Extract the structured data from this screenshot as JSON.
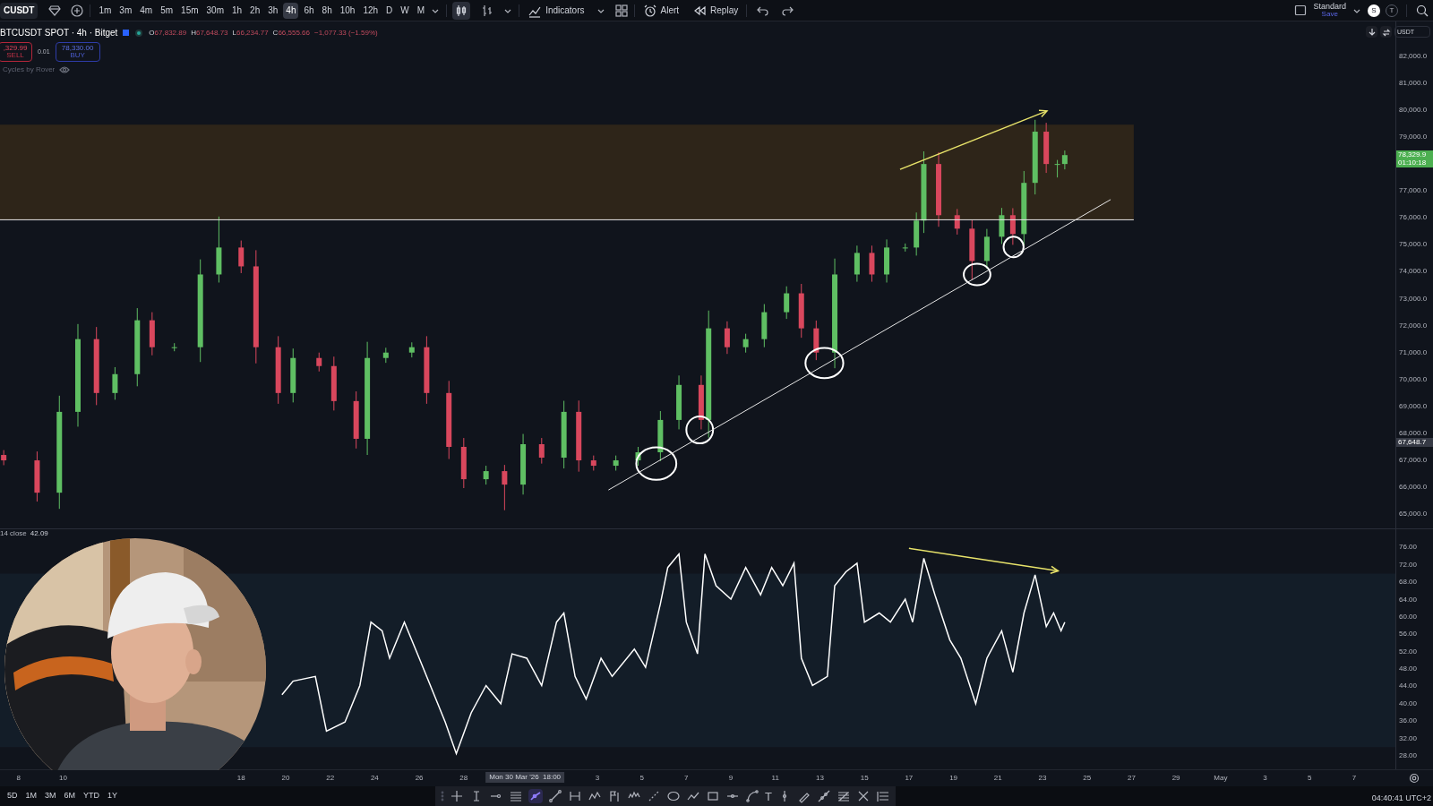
{
  "toolbar": {
    "symbol": "CUSDT",
    "intervals": [
      {
        "label": "1m",
        "selected": false
      },
      {
        "label": "3m",
        "selected": false
      },
      {
        "label": "4m",
        "selected": false
      },
      {
        "label": "5m",
        "selected": false
      },
      {
        "label": "15m",
        "selected": false
      },
      {
        "label": "30m",
        "selected": false
      },
      {
        "label": "1h",
        "selected": false
      },
      {
        "label": "2h",
        "selected": false
      },
      {
        "label": "3h",
        "selected": false
      },
      {
        "label": "4h",
        "selected": true
      },
      {
        "label": "6h",
        "selected": false
      },
      {
        "label": "8h",
        "selected": false
      },
      {
        "label": "10h",
        "selected": false
      },
      {
        "label": "12h",
        "selected": false
      },
      {
        "label": "D",
        "selected": false
      },
      {
        "label": "W",
        "selected": false
      },
      {
        "label": "M",
        "selected": false
      }
    ],
    "indicators_label": "Indicators",
    "alert_label": "Alert",
    "replay_label": "Replay",
    "layout_name": "Standard",
    "layout_action": "Save",
    "avatars": [
      {
        "letter": "S",
        "kind": "filled"
      },
      {
        "letter": "T",
        "kind": "outline"
      }
    ]
  },
  "legend": {
    "title": "BTCUSDT SPOT · 4h · Bitget",
    "ohlc": [
      {
        "key": "O",
        "value": "67,832.89"
      },
      {
        "key": "H",
        "value": "67,648.73"
      },
      {
        "key": "L",
        "value": "66,234.77"
      },
      {
        "key": "C",
        "value": "66,555.66"
      }
    ],
    "change": "−1,077.33 (−1.59%)"
  },
  "trade": {
    "sell_price": ",329.99",
    "sell_label": "SELL",
    "spread": "0.01",
    "buy_price": "78,330.00",
    "buy_label": "BUY"
  },
  "indicators": [
    {
      "name": "Cycles by Rover"
    }
  ],
  "currency": "USDT",
  "price_chart": {
    "chart_data": {
      "type": "candlestick",
      "xlim": [
        "2026-03-07T04:00",
        "2026-05-10T13:00"
      ],
      "ylim": [
        64475,
        83290
      ],
      "x": [
        "2026-03-07T08:00",
        "2026-03-08T20:00",
        "2026-03-09T20:00",
        "2026-03-10T16:00",
        "2026-03-11T12:00",
        "2026-03-12T08:00",
        "2026-03-13T08:00",
        "2026-03-14T00:00",
        "2026-03-15T00:00",
        "2026-03-16T04:00",
        "2026-03-17T00:00",
        "2026-03-18T00:00",
        "2026-03-18T16:00",
        "2026-03-19T16:00",
        "2026-03-20T08:00",
        "2026-03-21T12:00",
        "2026-03-22T04:00",
        "2026-03-23T04:00",
        "2026-03-23T16:00",
        "2026-03-24T12:00",
        "2026-03-25T16:00",
        "2026-03-26T08:00",
        "2026-03-27T08:00",
        "2026-03-28T00:00",
        "2026-03-29T00:00",
        "2026-03-29T20:00",
        "2026-03-30T16:00",
        "2026-03-31T12:00",
        "2026-04-01T12:00",
        "2026-04-02T04:00",
        "2026-04-02T20:00",
        "2026-04-03T20:00",
        "2026-04-04T20:00",
        "2026-04-05T20:00",
        "2026-04-06T16:00",
        "2026-04-07T16:00",
        "2026-04-08T00:00",
        "2026-04-08T20:00",
        "2026-04-09T16:00",
        "2026-04-10T12:00",
        "2026-04-11T12:00",
        "2026-04-12T04:00",
        "2026-04-12T20:00",
        "2026-04-13T16:00",
        "2026-04-14T16:00",
        "2026-04-15T08:00",
        "2026-04-16T00:00",
        "2026-04-16T20:00",
        "2026-04-17T08:00",
        "2026-04-17T16:00",
        "2026-04-18T08:00",
        "2026-04-19T04:00",
        "2026-04-19T20:00",
        "2026-04-20T12:00",
        "2026-04-21T04:00",
        "2026-04-21T16:00",
        "2026-04-22T04:00",
        "2026-04-22T16:00",
        "2026-04-23T04:00",
        "2026-04-23T16:00",
        "2026-04-24T00:00"
      ],
      "ohlc": [
        [
          67200,
          67380,
          66820,
          67000
        ],
        [
          67000,
          67330,
          65470,
          65800
        ],
        [
          65800,
          69400,
          65200,
          68800
        ],
        [
          68800,
          72060,
          68250,
          71500
        ],
        [
          71500,
          71950,
          69050,
          69500
        ],
        [
          69500,
          70460,
          69250,
          70200
        ],
        [
          70200,
          72650,
          69750,
          72200
        ],
        [
          72200,
          72500,
          70900,
          71200
        ],
        [
          71200,
          71350,
          71050,
          71200
        ],
        [
          71200,
          74460,
          70650,
          73900
        ],
        [
          73900,
          76050,
          73600,
          74900
        ],
        [
          74900,
          75160,
          73950,
          74200
        ],
        [
          74200,
          74800,
          70600,
          71200
        ],
        [
          71200,
          71610,
          69100,
          69500
        ],
        [
          69500,
          71150,
          69150,
          70800
        ],
        [
          70800,
          71000,
          70300,
          70500
        ],
        [
          70500,
          70850,
          68850,
          69200
        ],
        [
          69200,
          69560,
          67440,
          67800
        ],
        [
          67800,
          71400,
          67200,
          70800
        ],
        [
          70800,
          71180,
          70620,
          71000
        ],
        [
          71000,
          71380,
          70820,
          71200
        ],
        [
          71200,
          71610,
          69100,
          69500
        ],
        [
          69500,
          69950,
          67050,
          67500
        ],
        [
          67500,
          67830,
          65970,
          66300
        ],
        [
          66300,
          66800,
          66100,
          66600
        ],
        [
          66600,
          66830,
          65150,
          66100
        ],
        [
          66100,
          67980,
          65730,
          67600
        ],
        [
          67600,
          67830,
          66880,
          67100
        ],
        [
          67100,
          69210,
          66700,
          68800
        ],
        [
          68800,
          69220,
          66580,
          67000
        ],
        [
          67000,
          67180,
          66620,
          66800
        ],
        [
          66800,
          67180,
          66620,
          67000
        ],
        [
          67000,
          67500,
          66800,
          67300
        ],
        [
          67300,
          68830,
          66970,
          68500
        ],
        [
          68500,
          70150,
          68150,
          69800
        ],
        [
          69800,
          70150,
          68150,
          68500
        ],
        [
          68500,
          72560,
          67840,
          71900
        ],
        [
          71900,
          72160,
          70950,
          71200
        ],
        [
          71200,
          71700,
          71000,
          71500
        ],
        [
          71500,
          72800,
          71200,
          72500
        ],
        [
          72500,
          73460,
          72250,
          73200
        ],
        [
          73200,
          73550,
          71550,
          71900
        ],
        [
          71900,
          72190,
          70720,
          71000
        ],
        [
          71000,
          74490,
          70420,
          73900
        ],
        [
          73900,
          74970,
          73630,
          74700
        ],
        [
          74700,
          74970,
          73630,
          73900
        ],
        [
          73900,
          75200,
          73600,
          74900
        ],
        [
          74900,
          75050,
          74750,
          74900
        ],
        [
          74900,
          76200,
          74600,
          75900
        ],
        [
          75900,
          78470,
          75440,
          78000
        ],
        [
          78000,
          78440,
          75670,
          76100
        ],
        [
          76100,
          76330,
          75380,
          75600
        ],
        [
          75600,
          75930,
          73700,
          74400
        ],
        [
          74400,
          75590,
          74120,
          75300
        ],
        [
          75300,
          76370,
          75030,
          76100
        ],
        [
          76100,
          76360,
          75000,
          75400
        ],
        [
          75400,
          77740,
          74970,
          77300
        ],
        [
          77300,
          79640,
          76870,
          79200
        ],
        [
          79200,
          79530,
          77670,
          78000
        ],
        [
          78000,
          78150,
          77500,
          78000
        ],
        [
          78000,
          78500,
          77800,
          78330
        ]
      ],
      "yticks": [
        {
          "value": 82000,
          "label": "82,000.0"
        },
        {
          "value": 81000,
          "label": "81,000.0"
        },
        {
          "value": 80000,
          "label": "80,000.0"
        },
        {
          "value": 79000,
          "label": "79,000.0"
        },
        {
          "value": 77000,
          "label": "77,000.0"
        },
        {
          "value": 76000,
          "label": "76,000.0"
        },
        {
          "value": 75000,
          "label": "75,000.0"
        },
        {
          "value": 74000,
          "label": "74,000.0"
        },
        {
          "value": 73000,
          "label": "73,000.0"
        },
        {
          "value": 72000,
          "label": "72,000.0"
        },
        {
          "value": 71000,
          "label": "71,000.0"
        },
        {
          "value": 70000,
          "label": "70,000.0"
        },
        {
          "value": 69000,
          "label": "69,000.0"
        },
        {
          "value": 68000,
          "label": "68,000.0"
        },
        {
          "value": 67000,
          "label": "67,000.0"
        },
        {
          "value": 66000,
          "label": "66,000.0"
        },
        {
          "value": 65000,
          "label": "65,000.0"
        }
      ]
    },
    "price_labels": [
      {
        "kind": "last",
        "label": "78,329.9",
        "countdown": "01:10:18"
      },
      {
        "kind": "high",
        "label": "67,648.7"
      }
    ]
  },
  "rsi": {
    "label": "14 close",
    "value": "42.09",
    "chart_data": {
      "type": "line",
      "xlim": [
        "2026-03-07T04:00",
        "2026-05-10T13:00"
      ],
      "ylim": [
        24.7,
        80.2
      ],
      "x": [
        "2026-03-19T20:00",
        "2026-03-20T08:00",
        "2026-03-21T08:00",
        "2026-03-21T20:00",
        "2026-03-22T16:00",
        "2026-03-23T08:00",
        "2026-03-23T20:00",
        "2026-03-24T08:00",
        "2026-03-24T16:00",
        "2026-03-25T08:00",
        "2026-03-26T00:00",
        "2026-03-26T16:00",
        "2026-03-27T04:00",
        "2026-03-27T16:00",
        "2026-03-28T08:00",
        "2026-03-29T00:00",
        "2026-03-29T16:00",
        "2026-03-30T04:00",
        "2026-03-30T20:00",
        "2026-03-31T12:00",
        "2026-04-01T04:00",
        "2026-04-01T12:00",
        "2026-04-02T00:00",
        "2026-04-02T12:00",
        "2026-04-03T04:00",
        "2026-04-03T16:00",
        "2026-04-04T16:00",
        "2026-04-05T04:00",
        "2026-04-05T20:00",
        "2026-04-06T04:00",
        "2026-04-06T16:00",
        "2026-04-07T00:00",
        "2026-04-07T12:00",
        "2026-04-07T20:00",
        "2026-04-08T08:00",
        "2026-04-09T00:00",
        "2026-04-09T16:00",
        "2026-04-10T08:00",
        "2026-04-10T20:00",
        "2026-04-11T08:00",
        "2026-04-11T20:00",
        "2026-04-12T04:00",
        "2026-04-12T16:00",
        "2026-04-13T08:00",
        "2026-04-13T16:00",
        "2026-04-14T04:00",
        "2026-04-14T16:00",
        "2026-04-15T00:00",
        "2026-04-15T16:00",
        "2026-04-16T04:00",
        "2026-04-16T20:00",
        "2026-04-17T04:00",
        "2026-04-17T16:00",
        "2026-04-18T04:00",
        "2026-04-18T20:00",
        "2026-04-19T08:00",
        "2026-04-20T00:00",
        "2026-04-20T12:00",
        "2026-04-21T04:00",
        "2026-04-21T16:00",
        "2026-04-22T04:00",
        "2026-04-22T16:00",
        "2026-04-23T04:00",
        "2026-04-23T12:00",
        "2026-04-23T20:00",
        "2026-04-24T00:00"
      ],
      "series": [
        {
          "color": "#ffffff",
          "values": [
            42.1,
            45.2,
            46.3,
            33.7,
            35.8,
            44.2,
            58.8,
            56.8,
            50.5,
            58.8,
            50.5,
            42.1,
            35.8,
            28.5,
            37.9,
            44.2,
            40.0,
            51.5,
            50.5,
            44.2,
            58.8,
            60.9,
            46.3,
            41.1,
            50.5,
            46.3,
            52.6,
            48.4,
            63.0,
            71.4,
            74.5,
            58.8,
            51.5,
            74.5,
            67.2,
            64.1,
            71.4,
            65.1,
            71.4,
            67.2,
            72.4,
            50.5,
            44.2,
            46.3,
            67.2,
            70.4,
            72.4,
            58.8,
            60.9,
            58.8,
            64.1,
            58.8,
            73.5,
            65.1,
            54.7,
            50.5,
            40.0,
            50.5,
            56.8,
            47.3,
            60.9,
            69.7,
            57.8,
            60.9,
            56.8,
            58.8
          ]
        }
      ],
      "yticks": [
        {
          "value": 76,
          "label": "76.00"
        },
        {
          "value": 72,
          "label": "72.00"
        },
        {
          "value": 68,
          "label": "68.00"
        },
        {
          "value": 64,
          "label": "64.00"
        },
        {
          "value": 60,
          "label": "60.00"
        },
        {
          "value": 56,
          "label": "56.00"
        },
        {
          "value": 52,
          "label": "52.00"
        },
        {
          "value": 48,
          "label": "48.00"
        },
        {
          "value": 44,
          "label": "44.00"
        },
        {
          "value": 40,
          "label": "40.00"
        },
        {
          "value": 36,
          "label": "36.00"
        },
        {
          "value": 32,
          "label": "32.00"
        },
        {
          "value": 28,
          "label": "28.00"
        }
      ],
      "xticks": [
        {
          "value": "2026-03-08T00:00",
          "label": "8"
        },
        {
          "value": "2026-03-10T00:00",
          "label": "10"
        },
        {
          "value": "2026-03-18T00:00",
          "label": "18"
        },
        {
          "value": "2026-03-20T00:00",
          "label": "20"
        },
        {
          "value": "2026-03-22T00:00",
          "label": "22"
        },
        {
          "value": "2026-03-24T00:00",
          "label": "24"
        },
        {
          "value": "2026-03-26T00:00",
          "label": "26"
        },
        {
          "value": "2026-03-28T00:00",
          "label": "28"
        },
        {
          "value": "2026-04-03T00:00",
          "label": "3"
        },
        {
          "value": "2026-04-05T00:00",
          "label": "5"
        },
        {
          "value": "2026-04-07T00:00",
          "label": "7"
        },
        {
          "value": "2026-04-09T00:00",
          "label": "9"
        },
        {
          "value": "2026-04-11T00:00",
          "label": "11"
        },
        {
          "value": "2026-04-13T00:00",
          "label": "13"
        },
        {
          "value": "2026-04-15T00:00",
          "label": "15"
        },
        {
          "value": "2026-04-17T00:00",
          "label": "17"
        },
        {
          "value": "2026-04-19T00:00",
          "label": "19"
        },
        {
          "value": "2026-04-21T00:00",
          "label": "21"
        },
        {
          "value": "2026-04-23T00:00",
          "label": "23"
        },
        {
          "value": "2026-04-25T00:00",
          "label": "25"
        },
        {
          "value": "2026-04-27T00:00",
          "label": "27"
        },
        {
          "value": "2026-04-29T00:00",
          "label": "29"
        },
        {
          "value": "2026-05-01T00:00",
          "label": "May"
        },
        {
          "value": "2026-05-03T00:00",
          "label": "3"
        },
        {
          "value": "2026-05-05T00:00",
          "label": "5"
        },
        {
          "value": "2026-05-07T00:00",
          "label": "7"
        }
      ]
    }
  },
  "crosshair_time": "Mon 30 Mar '26  18:00",
  "ranges": [
    "5D",
    "1M",
    "3M",
    "6M",
    "YTD",
    "1Y"
  ],
  "drawing_tools": [
    {
      "kind": "crosshair",
      "selected": false
    },
    {
      "kind": "cursor",
      "selected": false
    },
    {
      "kind": "ray",
      "selected": false
    },
    {
      "kind": "parallel",
      "selected": false
    },
    {
      "kind": "angle",
      "selected": true
    },
    {
      "kind": "trendline",
      "selected": false
    },
    {
      "kind": "range",
      "selected": false
    },
    {
      "kind": "pattern",
      "selected": false
    },
    {
      "kind": "flag",
      "selected": false
    },
    {
      "kind": "wave",
      "selected": false
    },
    {
      "kind": "segment",
      "selected": false
    },
    {
      "kind": "ellipse",
      "selected": false
    },
    {
      "kind": "path",
      "selected": false
    },
    {
      "kind": "rectangle",
      "selected": false
    },
    {
      "kind": "hray",
      "selected": false
    },
    {
      "kind": "curve",
      "selected": false
    },
    {
      "kind": "text",
      "label": "T",
      "selected": false
    },
    {
      "kind": "vline",
      "selected": false
    },
    {
      "kind": "brush",
      "selected": false
    },
    {
      "kind": "extended",
      "selected": false
    },
    {
      "kind": "fib",
      "selected": false
    },
    {
      "kind": "cross",
      "selected": false
    },
    {
      "kind": "list",
      "selected": false
    }
  ],
  "clock": "04:40:41 UTC+2"
}
